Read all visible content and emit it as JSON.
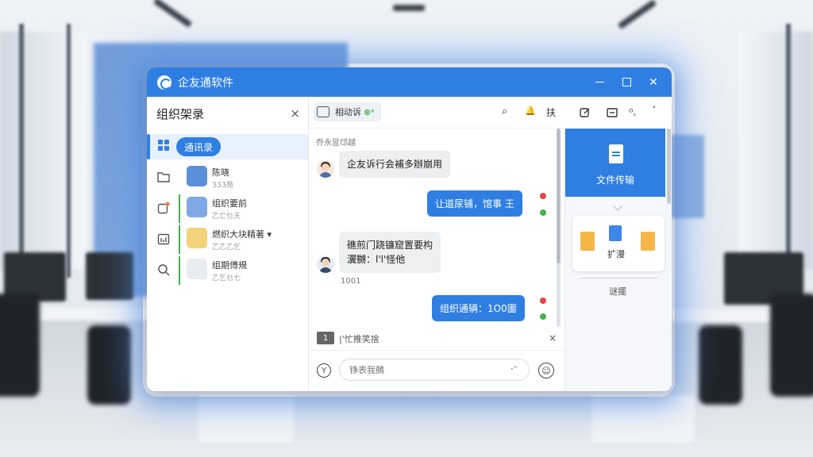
{
  "window": {
    "title": "企友通软件"
  },
  "left_panel": {
    "title": "组织架录",
    "close_label": "×",
    "selected_chip": "通讯录",
    "contacts": [
      {
        "name": "陈晓",
        "sub": "ƷƷƷ苑"
      },
      {
        "name": "组织要前",
        "sub": "乙亡乜天"
      },
      {
        "name": "燃织大块精著 ▾",
        "sub": "乙乙乙乞"
      },
      {
        "name": "组期傅規",
        "sub": "乙乞乜七"
      }
    ]
  },
  "toolbar": {
    "chip_label": "相动诉",
    "chip_badge": "⊛ᶜ",
    "icons": {
      "search": "⌕",
      "bell": "🔔",
      "tool_text": "扶",
      "edit": "⊡",
      "inbox": "⊟",
      "more": "ᴼ꜀",
      "collapse": "˅"
    }
  },
  "chat": {
    "date_label": "乔永昱邙越",
    "messages": [
      {
        "dir": "in",
        "text": "企友诉行会補多辦崩用"
      },
      {
        "dir": "out",
        "text": "让道尿铺，馆事 王"
      },
      {
        "dir": "in",
        "text": "礁煎门跷镰窟置要构\n瀷嬲：l'l'怪他",
        "time": "1001"
      },
      {
        "dir": "out",
        "text": "组织通辆：1O0圕"
      }
    ],
    "reply": {
      "num": "1",
      "text": "|'忙推笑捨",
      "close": "×"
    },
    "composer": {
      "placeholder": "铮表我鵺",
      "left_icon": "Y",
      "inner_icon": "·ᵔ",
      "emoji_icon": "☺"
    }
  },
  "right_panel": {
    "file_transfer_label": "文件传输",
    "files_label": "扩漫",
    "more_label": "谜擺"
  },
  "colors": {
    "accent": "#2f7fe3",
    "online": "#43b04c",
    "alert": "#e84545"
  }
}
